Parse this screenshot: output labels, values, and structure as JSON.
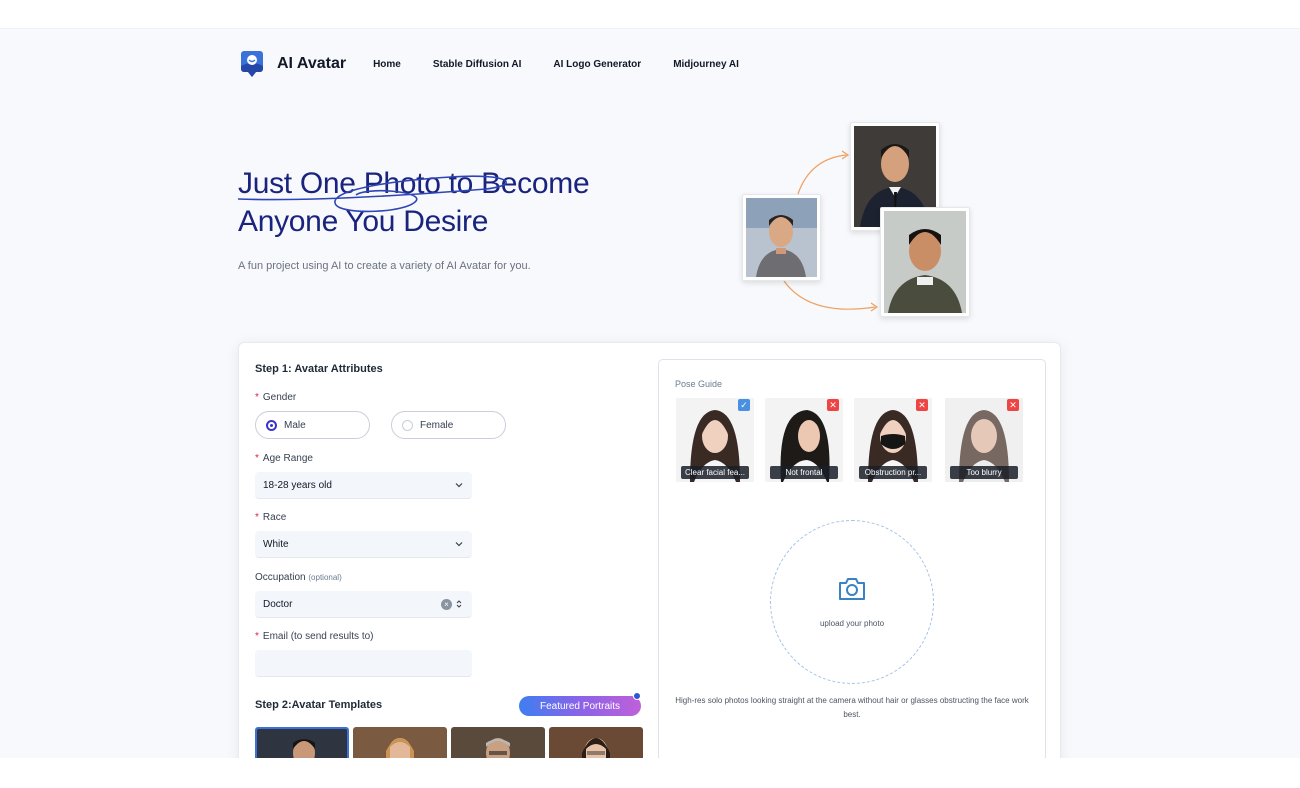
{
  "brand": {
    "name": "AI Avatar"
  },
  "nav": [
    "Home",
    "Stable Diffusion AI",
    "AI Logo Generator",
    "Midjourney AI"
  ],
  "hero": {
    "title_line1": "Just One Photo to Become",
    "title_line2": "Anyone You Desire",
    "subtitle": "A fun project using AI to create a variety of AI Avatar for you."
  },
  "step1": {
    "title": "Step 1: Avatar Attributes",
    "gender": {
      "label": "Gender",
      "options": [
        "Male",
        "Female"
      ],
      "selected": "Male"
    },
    "age": {
      "label": "Age Range",
      "value": "18-28 years old"
    },
    "race": {
      "label": "Race",
      "value": "White"
    },
    "occupation": {
      "label": "Occupation",
      "optional": "(optional)",
      "value": "Doctor"
    },
    "email": {
      "label": "Email (to send results to)",
      "value": ""
    }
  },
  "step2": {
    "title": "Step 2:Avatar Templates",
    "featured_label": "Featured Portraits"
  },
  "pose_guide": {
    "title": "Pose Guide",
    "items": [
      {
        "caption": "Clear facial fea...",
        "status": "ok"
      },
      {
        "caption": "Not frontal",
        "status": "bad"
      },
      {
        "caption": "Obstruction pr...",
        "status": "bad"
      },
      {
        "caption": "Too blurry",
        "status": "bad"
      }
    ],
    "upload_label": "upload your photo",
    "hint": "High-res solo photos looking straight at the camera without hair or glasses obstructing the face work best."
  },
  "colors": {
    "brand_navy": "#1a237e",
    "accent_blue": "#3b35c9",
    "ok_badge": "#4a90e2",
    "bad_badge": "#ef4444"
  }
}
